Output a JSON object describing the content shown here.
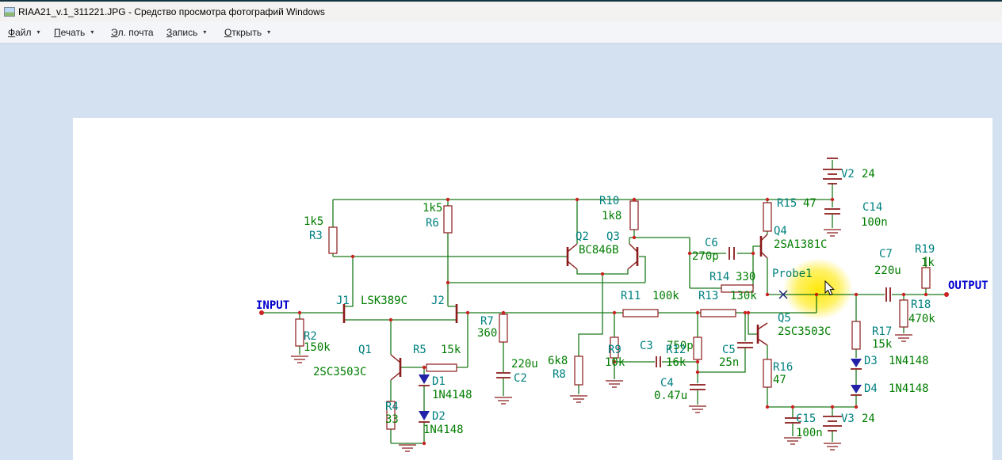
{
  "window": {
    "title": "RIAA21_v.1_311221.JPG - Средство просмотра фотографий Windows"
  },
  "menubar": {
    "items": [
      {
        "key": "Ф",
        "rest": "айл",
        "arrow": "▾"
      },
      {
        "key": "П",
        "rest": "ечать",
        "arrow": "▾"
      },
      {
        "key": "Э",
        "rest": "л. почта",
        "arrow": ""
      },
      {
        "key": "З",
        "rest": "апись",
        "arrow": "▾"
      },
      {
        "key": "О",
        "rest": "ткрыть",
        "arrow": "▾"
      }
    ]
  },
  "colors": {
    "wire": "#1b7a1b",
    "component": "#8b1a1a",
    "designator": "#008080",
    "value": "#007d00",
    "io": "#0000cc",
    "node": "#cc2222",
    "highlight": "#ffe800",
    "canvas_bg": "#d3e1f1"
  },
  "schematic": {
    "description": "RIAA phono preamplifier circuit",
    "labels": [
      "INPUT",
      "OUTPUT",
      "R2",
      "150k",
      "1k5",
      "R3",
      "J1",
      "LSK389C",
      "J2",
      "1k5",
      "R6",
      "Q1",
      "2SC3503C",
      "R5",
      "15k",
      "D1",
      "1N4148",
      "D2",
      "1N4148",
      "R4",
      "33",
      "R7",
      "360",
      "220u",
      "C2",
      "6k8",
      "R8",
      "Q2",
      "Q3",
      "BC846B",
      "R10",
      "1k8",
      "R11",
      "100k",
      "R13",
      "130k",
      "R9",
      "10k",
      "C3",
      "750p",
      "R12",
      "16k",
      "C4",
      "0.47u",
      "C5",
      "25n",
      "C6",
      "270p",
      "R14",
      "330",
      "Q4",
      "2SA1381C",
      "R15",
      "47",
      "V2",
      "24",
      "C14",
      "100n",
      "Probe1",
      "Q5",
      "2SC3503C",
      "R16",
      "47",
      "R17",
      "15k",
      "D3",
      "1N4148",
      "D4",
      "1N4148",
      "C7",
      "220u",
      "R19",
      "1k",
      "R18",
      "470k",
      "C15",
      "100n",
      "V3",
      "24"
    ]
  }
}
